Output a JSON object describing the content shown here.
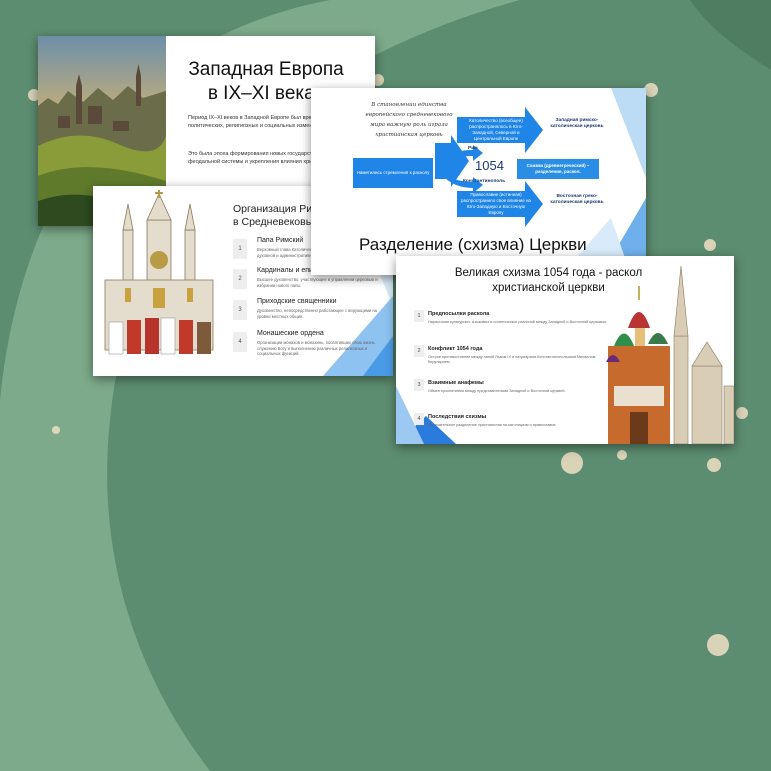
{
  "colors": {
    "background": "#5d8d70",
    "arc": "#88b493",
    "accent_blue": "#1f86e8"
  },
  "slide1": {
    "title_line1": "Западная Европа",
    "title_line2": "в IX–XI веках",
    "p1": "Период IX–XI веков в Западной Европе был временем значительных политических, религиозных и социальных изменений.",
    "p2": "Это была эпоха формирования новых государств, развития феодальной системы и укрепления влияния христианской церкви."
  },
  "slide2": {
    "title": "Организация Римской церкви в Средневековье",
    "items": [
      {
        "num": "1",
        "heading": "Папа Римский",
        "desc": "Верховный глава Католической церкви, обладающий высшей духовной и административной властью."
      },
      {
        "num": "2",
        "heading": "Кардиналы и епископы",
        "desc": "Высшее духовенство, участвующее в управлении церковью и избрании нового папы."
      },
      {
        "num": "3",
        "heading": "Приходские священники",
        "desc": "Духовенство, непосредственно работающее с верующими на уровне местных общин."
      },
      {
        "num": "4",
        "heading": "Монашеские ордена",
        "desc": "Организации монахов и монахинь, посвятивших свою жизнь служению Богу и выполнению различных религиозных и социальных функций."
      }
    ]
  },
  "slide3": {
    "handwritten": "В становлении единства европейского средневекового мира важную роль играла христианская церковь",
    "box_left": "Наметились стремления к расколу",
    "box_top": "Католичество (всеобщее) распространялось в Юго-Западной, Северной и Центральной Европе",
    "box_bottom": "Православие (истинная) распространило свое влияние на Юго-Западную и Восточную Европу",
    "box_middle": "Схизма (древнегреческий) – разделение, раскол.",
    "rome": "Рим",
    "year": "1054",
    "constantinople": "Константинополь",
    "west_church": "Западная римско-католическая церковь",
    "east_church": "Восточная греко-католическая церковь",
    "title": "Разделение (схизма) Церкви"
  },
  "slide4": {
    "title": "Великая схизма 1054 года - раскол христианской церкви",
    "items": [
      {
        "num": "1",
        "heading": "Предпосылки раскола",
        "desc": "Нарастание культурных, языковых и политических различий между Западной и Восточной церковью."
      },
      {
        "num": "2",
        "heading": "Конфликт 1054 года",
        "desc": "Острое противостояние между папой Львом IX и патриархом Константинопольским Михаилом Керуларием."
      },
      {
        "num": "3",
        "heading": "Взаимные анафемы",
        "desc": "Обмен проклятиями между представителями Западной и Восточной церквей."
      },
      {
        "num": "4",
        "heading": "Последствия схизмы",
        "desc": "Окончательное разделение христианства на католицизм и православие."
      }
    ]
  }
}
